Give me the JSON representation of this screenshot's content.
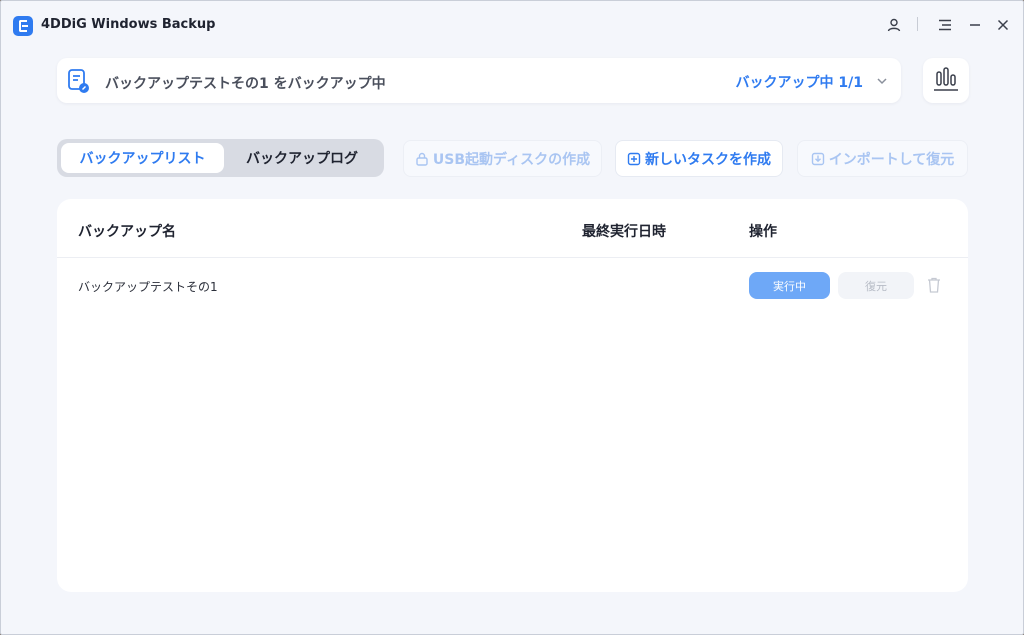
{
  "app": {
    "title": "4DDiG Windows Backup"
  },
  "icons": {
    "logo": "app-logo-icon",
    "user": "user-icon",
    "menu": "menu-icon",
    "minimize": "minimize-icon",
    "close": "close-icon",
    "status": "backup-document-icon",
    "chevron": "chevron-down-icon",
    "stats": "bar-chart-icon",
    "usb": "lock-icon",
    "new_task": "plus-square-icon",
    "import": "download-icon",
    "trash": "trash-icon"
  },
  "status": {
    "text": "バックアップテストその1 をバックアップ中",
    "progress": "バックアップ中 1/1"
  },
  "tabs": {
    "list": "バックアップリスト",
    "log": "バックアップログ"
  },
  "actions": {
    "usb": "USB起動ディスクの作成",
    "new_task": "新しいタスクを作成",
    "import": "インポートして復元"
  },
  "table": {
    "columns": {
      "name": "バックアップ名",
      "last_run": "最終実行日時",
      "ops": "操作"
    },
    "rows": [
      {
        "name": "バックアップテストその1",
        "last_run": "",
        "run": "実行中",
        "restore": "復元"
      }
    ]
  },
  "colors": {
    "accent": "#2f7bf0",
    "accent_light": "#6ea8f7",
    "background": "#f4f6fb"
  }
}
